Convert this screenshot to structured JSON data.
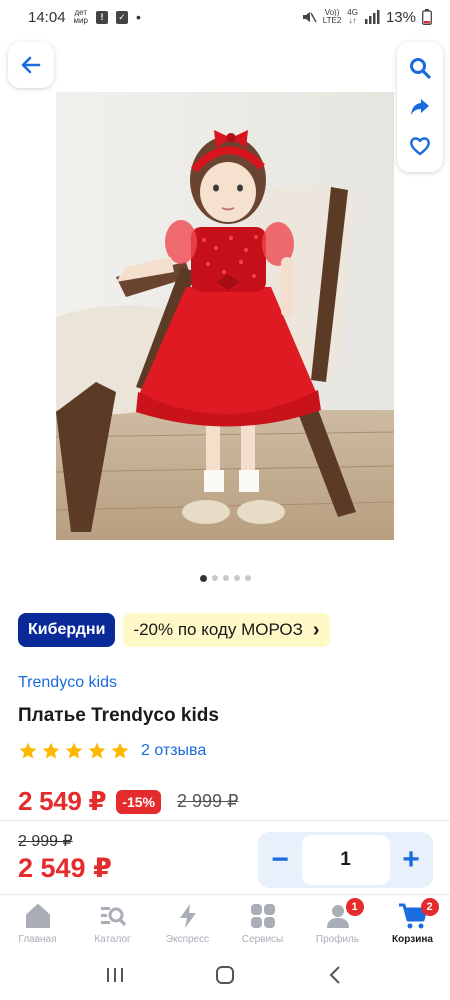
{
  "status_bar": {
    "time": "14:04",
    "left_small_top": "дет",
    "left_small_bottom": "мир",
    "net_top": "Vo))",
    "net_bottom": "LTE2",
    "net_type": "4G",
    "battery": "13%"
  },
  "gallery": {
    "total_images": 5,
    "active_index": 0
  },
  "promo": {
    "brand_badge": "Кибердни",
    "coupon_text": "-20% по коду МОРОЗ",
    "coupon_chevron": "›"
  },
  "product": {
    "brand": "Trendyco kids",
    "title": "Платье Trendyco kids",
    "rating_stars": 5,
    "reviews": "2 отзыва",
    "price_now": "2 549 ₽",
    "discount": "-15%",
    "price_old": "2 999 ₽"
  },
  "buy_bar": {
    "price_old": "2 999 ₽",
    "price_now": "2 549 ₽",
    "minus": "−",
    "quantity": "1",
    "plus": "+"
  },
  "tabs": [
    {
      "label": "Главная",
      "icon": "home-icon"
    },
    {
      "label": "Каталог",
      "icon": "catalog-search-icon"
    },
    {
      "label": "Экспресс",
      "icon": "lightning-icon"
    },
    {
      "label": "Сервисы",
      "icon": "services-icon"
    },
    {
      "label": "Профиль",
      "icon": "profile-icon",
      "badge": "1"
    },
    {
      "label": "Корзина",
      "icon": "cart-icon",
      "badge": "2",
      "active": true
    }
  ],
  "colors": {
    "accent_blue": "#1a6bdc",
    "price_red": "#e52b2b",
    "brand_navy": "#0a2a99",
    "promo_yellow": "#fff8c7"
  }
}
